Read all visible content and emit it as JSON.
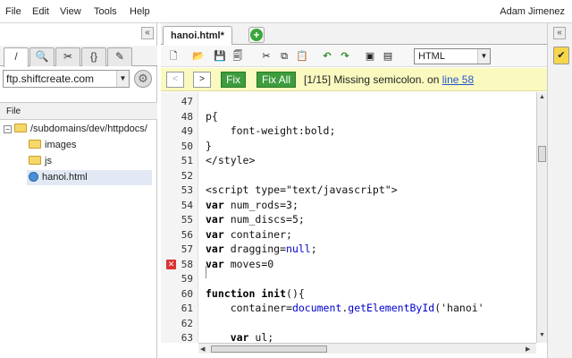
{
  "menu": {
    "items": [
      "File",
      "Edit",
      "View",
      "Tools",
      "Help"
    ],
    "user": "Adam Jimenez"
  },
  "left_panel": {
    "tabs": [
      "/",
      "🔍",
      "✂",
      "{}",
      "✎"
    ],
    "site": "ftp.shiftcreate.com",
    "file_header": "File",
    "tree": [
      {
        "label": "/subdomains/dev/httpdocs/",
        "type": "folder"
      },
      {
        "label": "images",
        "type": "folder"
      },
      {
        "label": "js",
        "type": "folder"
      },
      {
        "label": "hanoi.html",
        "type": "file"
      }
    ]
  },
  "editor": {
    "tab_name": "hanoi.html*",
    "language": "HTML",
    "error": {
      "prev": "<",
      "next": ">",
      "fix": "Fix",
      "fix_all": "Fix All",
      "message": "[1/15] Missing semicolon. on ",
      "link": "line 58"
    },
    "lines": [
      {
        "n": "47",
        "code": ""
      },
      {
        "n": "48",
        "code": "p{"
      },
      {
        "n": "49",
        "code": "    font-weight:bold;"
      },
      {
        "n": "50",
        "code": "}"
      },
      {
        "n": "51",
        "code": "</style>"
      },
      {
        "n": "52",
        "code": ""
      },
      {
        "n": "53",
        "code": "<script type=\"text/javascript\">"
      },
      {
        "n": "54",
        "code": "var num_rods=3;"
      },
      {
        "n": "55",
        "code": "var num_discs=5;"
      },
      {
        "n": "56",
        "code": "var container;"
      },
      {
        "n": "57",
        "code": "var dragging=null;"
      },
      {
        "n": "58",
        "code": "var moves=0"
      },
      {
        "n": "59",
        "code": ""
      },
      {
        "n": "60",
        "code": "function init(){"
      },
      {
        "n": "61",
        "code": "    container=document.getElementById('hanoi'"
      },
      {
        "n": "62",
        "code": ""
      },
      {
        "n": "63",
        "code": "    var ul;"
      }
    ]
  }
}
